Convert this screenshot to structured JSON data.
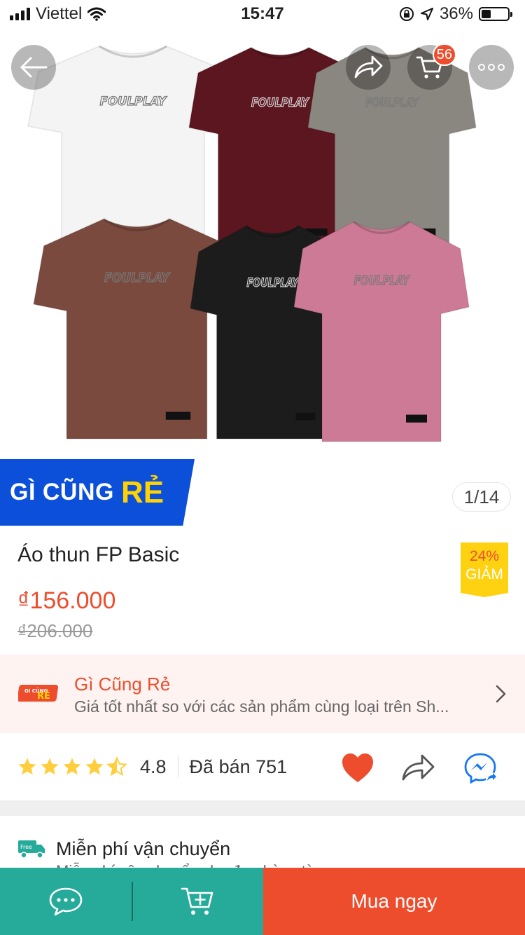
{
  "status_bar": {
    "carrier": "Viettel",
    "time": "15:47",
    "battery": "36%"
  },
  "product_gallery": {
    "counter": "1/14",
    "cart_count": "56",
    "shirt_colors": [
      "#f4f4f4",
      "#5c1620",
      "#8a8680",
      "#7a4a3e",
      "#1c1c1c",
      "#cc7a95"
    ],
    "logo_text": "FOULPLAY"
  },
  "banner": {
    "word1": "GÌ CŨNG",
    "word2": "RẺ"
  },
  "product": {
    "title": "Áo thun FP Basic",
    "price": "₫156.000",
    "old_price": "₫206.000",
    "discount_percent": "24%",
    "discount_label": "GIẢM"
  },
  "promo": {
    "logo_small": "GÌ CŨNG",
    "logo_big": "RẺ",
    "title": "Gì Cũng Rẻ",
    "subtitle": "Giá tốt nhất so với các sản phẩm cùng loại trên Sh..."
  },
  "rating": {
    "stars": 4.8,
    "value": "4.8",
    "sold": "Đã bán 751"
  },
  "shipping": {
    "badge": "Free",
    "title": "Miễn phí vận chuyển",
    "subtitle": "Miễn phí vận chuyển cho đơn hàng từ..."
  },
  "bottom_bar": {
    "buy_label": "Mua ngay"
  },
  "colors": {
    "accent": "#ee4d2d",
    "teal": "#26aa99",
    "banner_blue": "#0c4fd8",
    "yellow": "#ffd211"
  }
}
